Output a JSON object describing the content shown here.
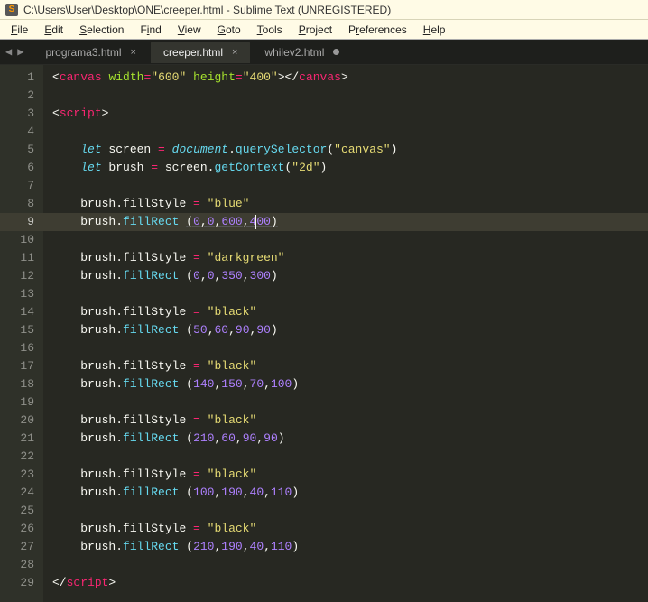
{
  "titlebar": {
    "app_icon_text": "S",
    "title": "C:\\Users\\User\\Desktop\\ONE\\creeper.html - Sublime Text (UNREGISTERED)"
  },
  "menubar": {
    "file": "File",
    "edit": "Edit",
    "selection": "Selection",
    "find": "Find",
    "view": "View",
    "goto": "Goto",
    "tools": "Tools",
    "project": "Project",
    "preferences": "Preferences",
    "help": "Help"
  },
  "tabs": {
    "nav_left": "◀",
    "nav_right": "▶",
    "t0": {
      "label": "programa3.html",
      "active": false,
      "modified": false
    },
    "t1": {
      "label": "creeper.html",
      "active": true,
      "modified": false
    },
    "t2": {
      "label": "whilev2.html",
      "active": false,
      "modified": true
    }
  },
  "active_line": 9,
  "code_tokens": {
    "canvas": "canvas",
    "width_attr": "width",
    "height_attr": "height",
    "w600": "\"600\"",
    "h400": "\"400\"",
    "script": "script",
    "let": "let",
    "screen": "screen",
    "eq": "=",
    "document": "document",
    "querySelector": "querySelector",
    "str_canvas": "\"canvas\"",
    "brush": "brush",
    "getContext": "getContext",
    "str_2d": "\"2d\"",
    "fillStyle": "fillStyle",
    "fillRect": "fillRect",
    "str_blue": "\"blue\"",
    "str_darkgreen": "\"darkgreen\"",
    "str_black": "\"black\"",
    "n0": "0",
    "n50": "50",
    "n60": "60",
    "n70": "70",
    "n90": "90",
    "n100": "100",
    "n110": "110",
    "n140": "140",
    "n150": "150",
    "n190": "190",
    "n210": "210",
    "n300": "300",
    "n350": "350",
    "n400": "400",
    "n40": "40",
    "n600": "600"
  },
  "line_numbers": [
    "1",
    "2",
    "3",
    "4",
    "5",
    "6",
    "7",
    "8",
    "9",
    "10",
    "11",
    "12",
    "13",
    "14",
    "15",
    "16",
    "17",
    "18",
    "19",
    "20",
    "21",
    "22",
    "23",
    "24",
    "25",
    "26",
    "27",
    "28",
    "29"
  ]
}
